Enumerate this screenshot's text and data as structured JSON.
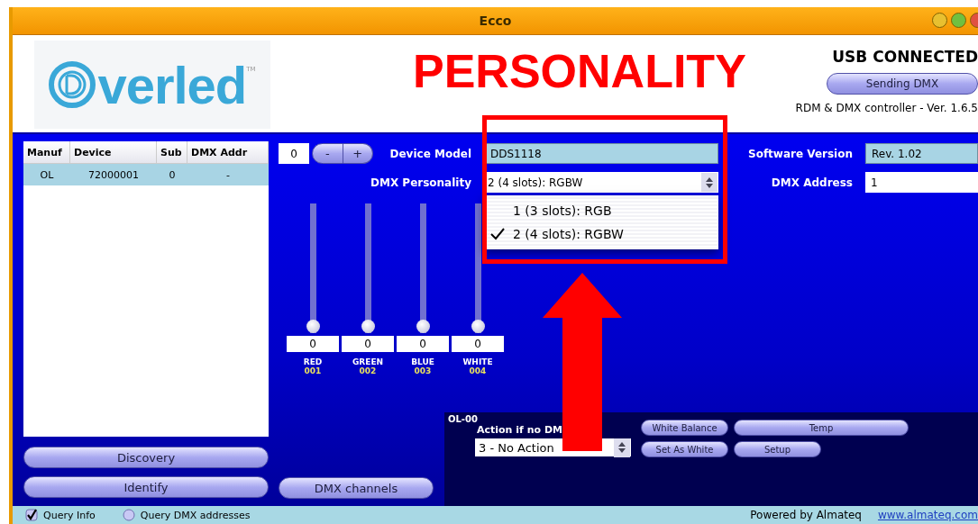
{
  "window": {
    "title": "Ecco"
  },
  "logo": {
    "text": "verled",
    "trademark": "TM"
  },
  "annotation": {
    "title": "PERSONALITY"
  },
  "connection": {
    "status": "USB CONNECTED",
    "button": "Sending DMX",
    "version": "RDM & DMX controller - Ver. 1.6.5"
  },
  "device_table": {
    "columns": [
      "Manuf",
      "Device",
      "Sub",
      "DMX Addr"
    ],
    "rows": [
      {
        "cells": [
          "OL",
          "72000001",
          "0",
          "-"
        ],
        "selected": true
      }
    ]
  },
  "left_buttons": [
    "Discovery",
    "Identify"
  ],
  "spinner": {
    "value": "0",
    "minus": "-",
    "plus": "+"
  },
  "device_model": {
    "label": "Device Model",
    "value": "DDS1118"
  },
  "software_version": {
    "label": "Software Version",
    "value": "Rev. 1.02"
  },
  "personality": {
    "label": "DMX Personality",
    "value": "2 (4 slots): RGBW",
    "options": [
      {
        "label": "1 (3 slots): RGB",
        "selected": false
      },
      {
        "label": "2 (4 slots): RGBW",
        "selected": true
      }
    ]
  },
  "dmx_address": {
    "label": "DMX Address",
    "value": "1"
  },
  "channels": [
    {
      "name": "RED",
      "number": "001",
      "value": "0",
      "level": 0
    },
    {
      "name": "GREEN",
      "number": "002",
      "value": "0",
      "level": 0
    },
    {
      "name": "BLUE",
      "number": "003",
      "value": "0",
      "level": 0
    },
    {
      "name": "WHITE",
      "number": "004",
      "value": "0",
      "level": 0
    }
  ],
  "dmx_channels_button": "DMX channels",
  "panel": {
    "title": "OL-00",
    "action_label": "Action if no DM",
    "action_value": "3 - No Action",
    "buttons": [
      {
        "label": "White Balance",
        "kind": "normal"
      },
      {
        "label": "Temp",
        "kind": "wide"
      },
      {
        "label": "Set As White",
        "kind": "normal"
      },
      {
        "label": "Setup",
        "kind": "normal"
      }
    ]
  },
  "status_bar": {
    "options": [
      {
        "kind": "checkbox",
        "label": "Query Info",
        "checked": true
      },
      {
        "kind": "radio",
        "label": "Query DMX addresses",
        "checked": false
      }
    ],
    "credit": "Powered by Almateq",
    "link": "www.almateq.com"
  }
}
